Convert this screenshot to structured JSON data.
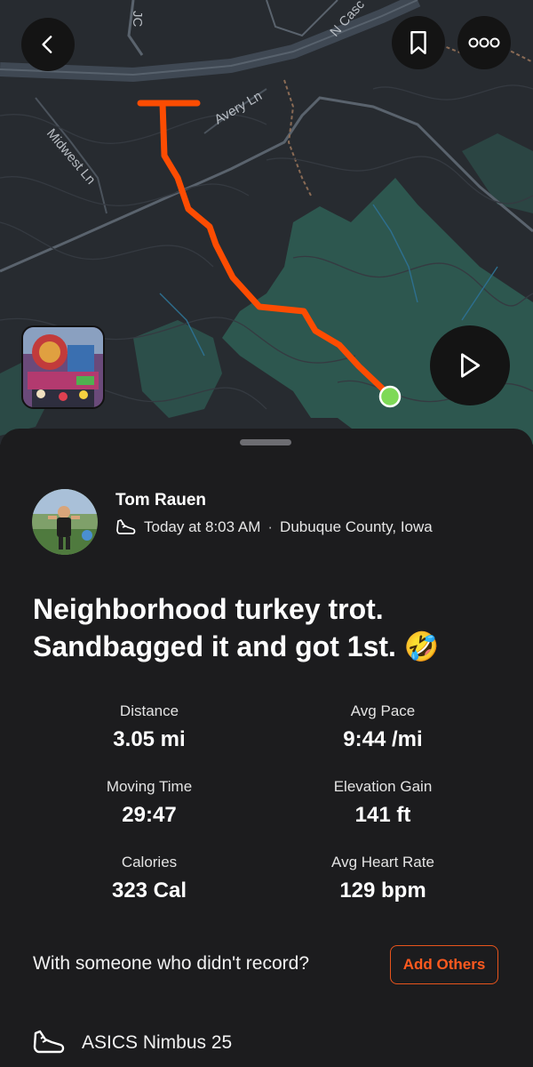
{
  "map": {
    "street_labels": [
      "Avery Ln",
      "Midwest Ln",
      "N Casc",
      "JC"
    ],
    "route_color": "#fc4c02",
    "end_marker_color": "#7ed957",
    "park_color": "#2f5f55"
  },
  "icons": {
    "back": "chevron-left-icon",
    "bookmark": "bookmark-icon",
    "more": "more-icon",
    "play": "play-icon",
    "sport": "running-shoe-icon"
  },
  "athlete": {
    "name": "Tom Rauen",
    "time": "Today at 8:03 AM",
    "separator": "·",
    "location": "Dubuque County, Iowa"
  },
  "activity": {
    "title_line1": "Neighborhood turkey trot.",
    "title_line2": "Sandbagged it and got 1st. 🤣"
  },
  "stats": [
    {
      "label": "Distance",
      "value": "3.05 mi"
    },
    {
      "label": "Avg Pace",
      "value": "9:44 /mi"
    },
    {
      "label": "Moving Time",
      "value": "29:47"
    },
    {
      "label": "Elevation Gain",
      "value": "141 ft"
    },
    {
      "label": "Calories",
      "value": "323 Cal"
    },
    {
      "label": "Avg Heart Rate",
      "value": "129 bpm"
    }
  ],
  "others": {
    "prompt": "With someone who didn't record?",
    "button": "Add Others"
  },
  "gear": {
    "name": "ASICS Nimbus 25"
  }
}
